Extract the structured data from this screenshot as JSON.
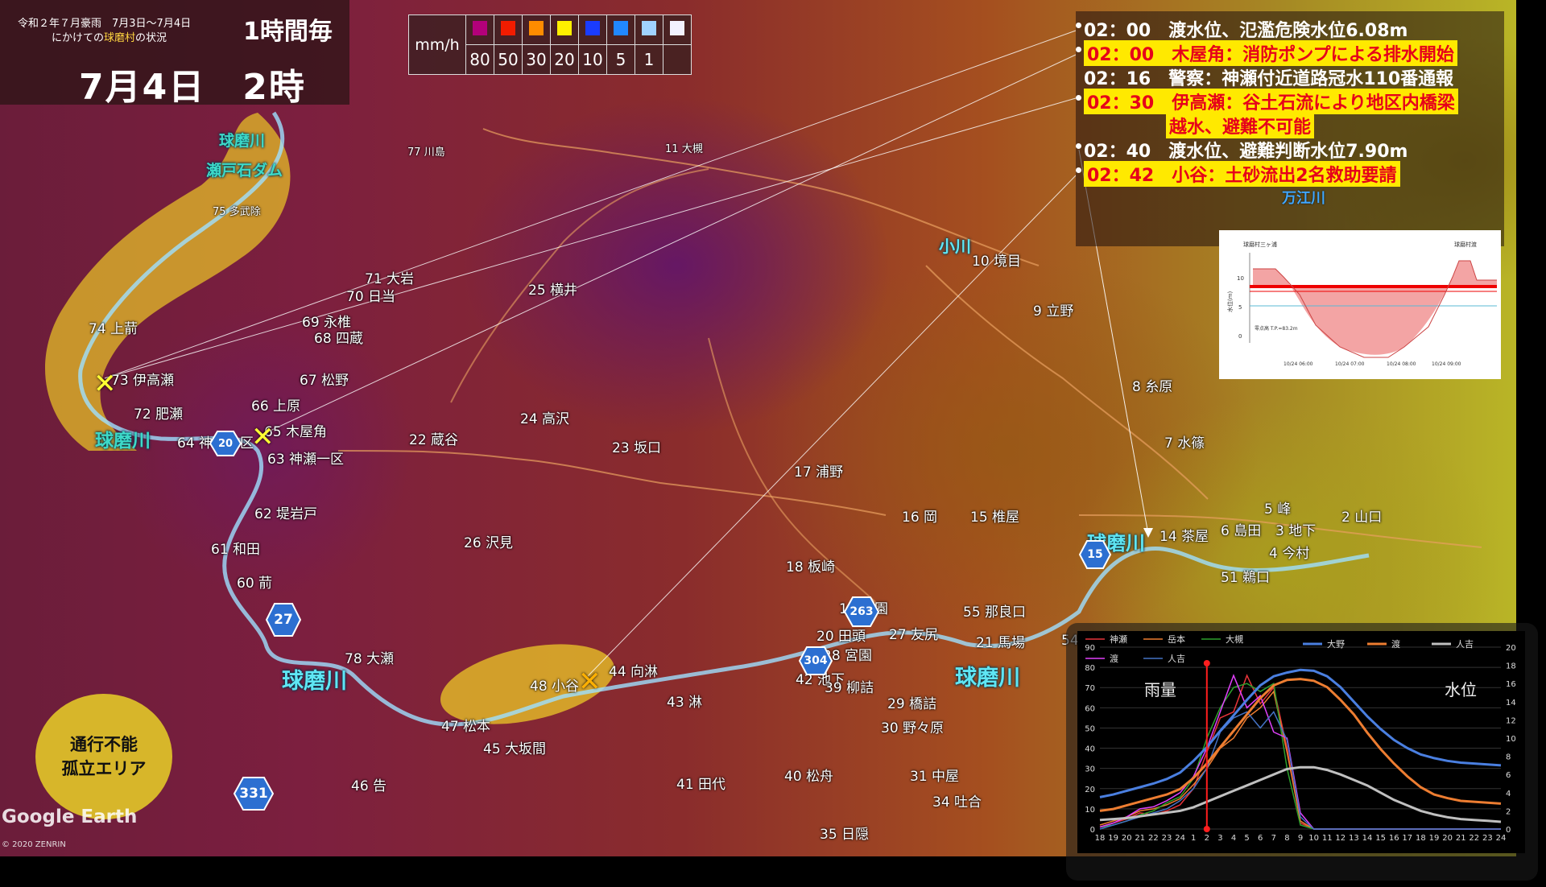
{
  "header": {
    "line1": "令和２年７月豪雨　7月3日〜7月4日",
    "line2_pre": "にかけての",
    "line2_hl": "球磨村",
    "line2_post": "の状況",
    "interval": "1時間毎",
    "date": "7月4日",
    "time": "2時"
  },
  "rain_legend": {
    "unit": "mm/h",
    "levels": [
      {
        "value": "80",
        "color": "#b3007a"
      },
      {
        "value": "50",
        "color": "#f21c00"
      },
      {
        "value": "30",
        "color": "#ff8c00"
      },
      {
        "value": "20",
        "color": "#fff000"
      },
      {
        "value": "10",
        "color": "#1a3cff"
      },
      {
        "value": "5",
        "color": "#2188ff"
      },
      {
        "value": "1",
        "color": "#a0d2ff"
      },
      {
        "value": "",
        "color": "#f2f2ff"
      }
    ]
  },
  "events": [
    {
      "text": "02：00　渡水位、氾濫危険水位6.08m",
      "highlight": false
    },
    {
      "text": "02：00　木屋角：消防ポンプによる排水開始",
      "highlight": true
    },
    {
      "text": "02：16　警察：神瀬付近道路冠水110番通報",
      "highlight": false
    },
    {
      "text": "02：30　伊高瀬：谷土石流により地区内橋梁",
      "highlight": true
    },
    {
      "text": "越水、避難不可能",
      "highlight": true
    },
    {
      "text": "02：40　渡水位、避難判断水位7.90m",
      "highlight": false
    },
    {
      "text": "02：42　小谷：土砂流出2名救助要請",
      "highlight": true
    }
  ],
  "map": {
    "places": [
      {
        "num": "77",
        "name": "川島"
      },
      {
        "num": "11",
        "name": "大槻"
      },
      {
        "num": "75",
        "name": "多武除"
      },
      {
        "num": "71",
        "name": "大岩"
      },
      {
        "num": "70",
        "name": "日当"
      },
      {
        "num": "25",
        "name": "横井"
      },
      {
        "num": "10",
        "name": "境目"
      },
      {
        "num": "69",
        "name": "永椎"
      },
      {
        "num": "68",
        "name": "四蔵"
      },
      {
        "num": "9",
        "name": "立野"
      },
      {
        "num": "74",
        "name": "上葥"
      },
      {
        "num": "67",
        "name": "松野"
      },
      {
        "num": "73",
        "name": "伊高瀬"
      },
      {
        "num": "8",
        "name": "糸原"
      },
      {
        "num": "72",
        "name": "肥瀬"
      },
      {
        "num": "66",
        "name": "上原"
      },
      {
        "num": "24",
        "name": "高沢"
      },
      {
        "num": "65",
        "name": "木屋角"
      },
      {
        "num": "64",
        "name": "神瀬二区"
      },
      {
        "num": "22",
        "name": "蔵谷"
      },
      {
        "num": "7",
        "name": "水篠"
      },
      {
        "num": "23",
        "name": "坂口"
      },
      {
        "num": "63",
        "name": "神瀬一区"
      },
      {
        "num": "17",
        "name": "浦野"
      },
      {
        "num": "62",
        "name": "堤岩戸"
      },
      {
        "num": "16",
        "name": "岡"
      },
      {
        "num": "15",
        "name": "椎屋"
      },
      {
        "num": "5",
        "name": "峰"
      },
      {
        "num": "14",
        "name": "茶屋"
      },
      {
        "num": "6",
        "name": "島田"
      },
      {
        "num": "3",
        "name": "地下"
      },
      {
        "num": "2",
        "name": "山口"
      },
      {
        "num": "26",
        "name": "沢見"
      },
      {
        "num": "61",
        "name": "和田"
      },
      {
        "num": "4",
        "name": "今村"
      },
      {
        "num": "18",
        "name": "板崎"
      },
      {
        "num": "51",
        "name": "鵜口"
      },
      {
        "num": "60",
        "name": "葥"
      },
      {
        "num": "19",
        "name": "中園"
      },
      {
        "num": "55",
        "name": "那良口"
      },
      {
        "num": "20",
        "name": "田頭"
      },
      {
        "num": "27",
        "name": "友尻"
      },
      {
        "num": "21",
        "name": "馬場"
      },
      {
        "num": "28",
        "name": "宮園"
      },
      {
        "num": "78",
        "name": "大瀬"
      },
      {
        "num": "44",
        "name": "向淋"
      },
      {
        "num": "42",
        "name": "池下"
      },
      {
        "num": "39",
        "name": "柳詰"
      },
      {
        "num": "48",
        "name": "小谷"
      },
      {
        "num": "43",
        "name": "淋"
      },
      {
        "num": "29",
        "name": "橋詰"
      },
      {
        "num": "47",
        "name": "松本"
      },
      {
        "num": "30",
        "name": "野々原"
      },
      {
        "num": "45",
        "name": "大坂間"
      },
      {
        "num": "46",
        "name": "告"
      },
      {
        "num": "41",
        "name": "田代"
      },
      {
        "num": "40",
        "name": "松舟"
      },
      {
        "num": "31",
        "name": "中屋"
      },
      {
        "num": "34",
        "name": "吐合"
      },
      {
        "num": "35",
        "name": "日隠"
      },
      {
        "num": "54",
        "name": ""
      }
    ],
    "rivers": [
      "球磨川",
      "瀬戸石ダム",
      "小川",
      "万江川"
    ],
    "routes": [
      "27",
      "331",
      "263",
      "304",
      "15",
      "20"
    ]
  },
  "hydro_graph": {
    "title_left": "球磨村三ヶ浦",
    "title_right": "球磨村渡",
    "ylabel": "水位(m)",
    "yticks": [
      "10",
      "5",
      "0"
    ],
    "note": "零点高 T.P.=83.2m",
    "xticks": [
      "10/24 06:00",
      "10/24 07:00",
      "10/24 08:00",
      "10/24 09:00"
    ]
  },
  "chart_data": {
    "type": "line",
    "x": [
      "18",
      "19",
      "20",
      "21",
      "22",
      "23",
      "24",
      "1",
      "2",
      "3",
      "4",
      "5",
      "6",
      "7",
      "8",
      "9",
      "10",
      "11",
      "12",
      "13",
      "14",
      "15",
      "16",
      "17",
      "18",
      "19",
      "20",
      "21",
      "22",
      "23",
      "24"
    ],
    "left_axis": {
      "label": "雨量",
      "ylim": [
        0,
        90
      ],
      "ticks": [
        0,
        10,
        20,
        30,
        40,
        50,
        60,
        70,
        80,
        90
      ]
    },
    "right_axis": {
      "label": "水位",
      "ylim": [
        0,
        20
      ],
      "ticks": [
        0,
        2,
        4,
        6,
        8,
        10,
        12,
        14,
        16,
        18,
        20
      ]
    },
    "series": [
      {
        "name": "神瀬",
        "axis": "left",
        "color": "#e8343a",
        "values": [
          1,
          3,
          5,
          8,
          7,
          9,
          12,
          20,
          38,
          55,
          58,
          76,
          62,
          70,
          40,
          3,
          0,
          0,
          0,
          0,
          0,
          0,
          0,
          0,
          0,
          0,
          0,
          0,
          0,
          0,
          0
        ]
      },
      {
        "name": "岳本",
        "axis": "left",
        "color": "#ed7d31",
        "values": [
          2,
          4,
          6,
          9,
          10,
          12,
          15,
          22,
          30,
          40,
          45,
          55,
          60,
          68,
          38,
          4,
          0,
          0,
          0,
          0,
          0,
          0,
          0,
          0,
          0,
          0,
          0,
          0,
          0,
          0,
          0
        ]
      },
      {
        "name": "大槻",
        "axis": "left",
        "color": "#2ca02c",
        "values": [
          1,
          2,
          4,
          7,
          9,
          13,
          16,
          25,
          45,
          60,
          70,
          72,
          68,
          72,
          30,
          2,
          0,
          0,
          0,
          0,
          0,
          0,
          0,
          0,
          0,
          0,
          0,
          0,
          0,
          0,
          0
        ]
      },
      {
        "name": "渡",
        "axis": "left",
        "color": "#e040fb",
        "values": [
          1,
          3,
          6,
          10,
          11,
          14,
          18,
          26,
          40,
          58,
          76,
          60,
          66,
          48,
          45,
          8,
          0,
          0,
          0,
          0,
          0,
          0,
          0,
          0,
          0,
          0,
          0,
          0,
          0,
          0,
          0
        ]
      },
      {
        "name": "人吉",
        "axis": "left",
        "color": "#4472c4",
        "values": [
          0,
          2,
          4,
          6,
          8,
          10,
          14,
          20,
          30,
          48,
          55,
          58,
          50,
          58,
          44,
          6,
          0,
          0,
          0,
          0,
          0,
          0,
          0,
          0,
          0,
          0,
          0,
          0,
          0,
          0,
          0
        ]
      },
      {
        "name": "大野",
        "axis": "right",
        "color": "#4a7fe0",
        "values": [
          3.5,
          3.8,
          4.2,
          4.6,
          5.0,
          5.5,
          6.2,
          7.5,
          9.0,
          10.8,
          12.5,
          14.2,
          15.8,
          16.8,
          17.2,
          17.5,
          17.4,
          16.8,
          15.6,
          14.0,
          12.4,
          11.0,
          9.8,
          8.9,
          8.2,
          7.8,
          7.5,
          7.3,
          7.2,
          7.1,
          7.0
        ]
      },
      {
        "name": "渡",
        "axis": "right",
        "color": "#ed7d31",
        "values": [
          2.0,
          2.2,
          2.6,
          3.0,
          3.4,
          3.8,
          4.4,
          5.6,
          7.2,
          9.0,
          10.8,
          12.6,
          14.4,
          15.8,
          16.4,
          16.5,
          16.3,
          15.6,
          14.2,
          12.6,
          10.6,
          8.8,
          7.2,
          5.8,
          4.6,
          3.8,
          3.4,
          3.1,
          3.0,
          2.9,
          2.8
        ]
      },
      {
        "name": "人吉",
        "axis": "right",
        "color": "#c0c0c0",
        "values": [
          1.0,
          1.1,
          1.2,
          1.4,
          1.6,
          1.8,
          2.0,
          2.4,
          3.0,
          3.6,
          4.2,
          4.8,
          5.4,
          6.0,
          6.6,
          6.8,
          6.8,
          6.5,
          6.0,
          5.4,
          4.8,
          4.0,
          3.2,
          2.6,
          2.0,
          1.6,
          1.3,
          1.1,
          1.0,
          0.9,
          0.8
        ]
      }
    ],
    "marker_x": "2"
  },
  "iso_legend": {
    "line1": "通行不能",
    "line2": "孤立エリア"
  },
  "credits": {
    "logo": "Google Earth",
    "copyright": "© 2020 ZENRIN"
  }
}
